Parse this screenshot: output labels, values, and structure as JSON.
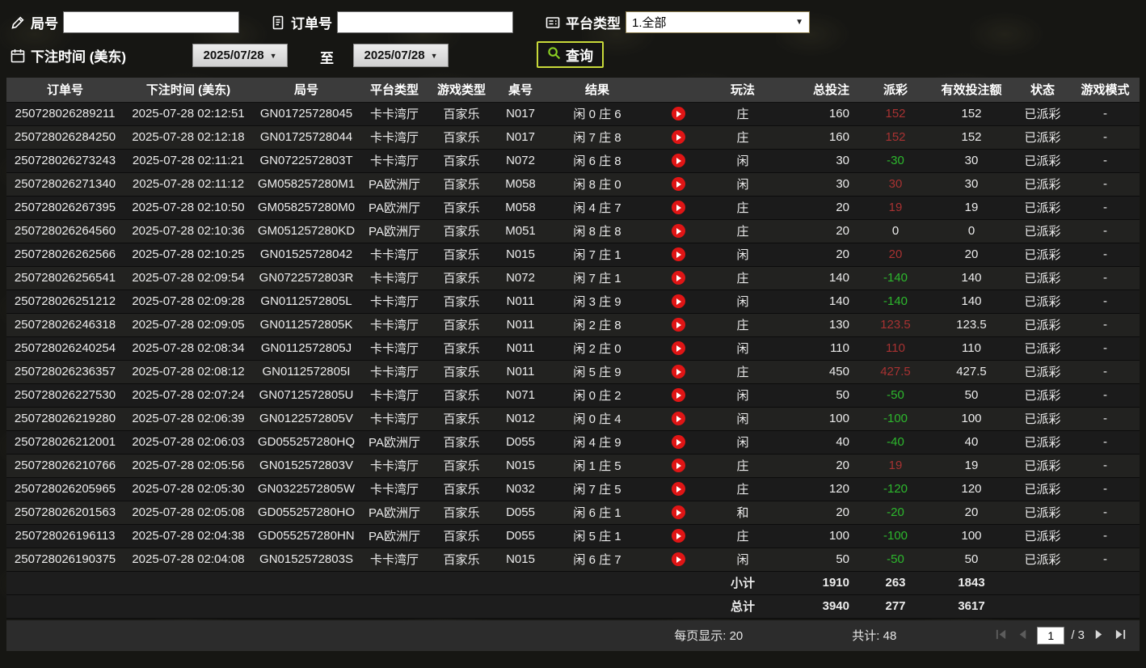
{
  "colors": {
    "accent_yellow": "#ffe100",
    "payout_win": "#a83232",
    "payout_loss": "#2db82d",
    "status_green": "#35c435",
    "header_red": "#e05050",
    "play_red": "#e01515",
    "query_border": "#c8d93a"
  },
  "icons": {
    "dropdown_arrow": "▼"
  },
  "filters": {
    "round_label": "局号",
    "order_label": "订单号",
    "platform_label": "平台类型",
    "platform_value": "1.全部",
    "bet_time_label": "下注时间 (美东)",
    "date_from": "2025/07/28",
    "to_label": "至",
    "date_to": "2025/07/28",
    "query_label": "查询",
    "round_input_value": "",
    "order_input_value": ""
  },
  "table": {
    "headers": [
      "订单号",
      "下注时间 (美东)",
      "局号",
      "平台类型",
      "游戏类型",
      "桌号",
      "结果",
      "玩法",
      "总投注",
      "派彩",
      "有效投注额",
      "状态",
      "游戏模式"
    ],
    "rows": [
      {
        "order_no": "250728026289211",
        "bet_time": "2025-07-28 02:12:51",
        "round_no": "GN01725728045",
        "platform": "卡卡湾厅",
        "game_type": "百家乐",
        "table_no": "N017",
        "result": "闲 0 庄 6",
        "play": "庄",
        "total_bet": "160",
        "payout": "152",
        "payout_class": "pos",
        "valid_bet": "152",
        "status": "已派彩",
        "mode": "-"
      },
      {
        "order_no": "250728026284250",
        "bet_time": "2025-07-28 02:12:18",
        "round_no": "GN01725728044",
        "platform": "卡卡湾厅",
        "game_type": "百家乐",
        "table_no": "N017",
        "result": "闲 7 庄 8",
        "play": "庄",
        "total_bet": "160",
        "payout": "152",
        "payout_class": "pos",
        "valid_bet": "152",
        "status": "已派彩",
        "mode": "-"
      },
      {
        "order_no": "250728026273243",
        "bet_time": "2025-07-28 02:11:21",
        "round_no": "GN0722572803T",
        "platform": "卡卡湾厅",
        "game_type": "百家乐",
        "table_no": "N072",
        "result": "闲 6 庄 8",
        "play": "闲",
        "total_bet": "30",
        "payout": "-30",
        "payout_class": "neg",
        "valid_bet": "30",
        "status": "已派彩",
        "mode": "-"
      },
      {
        "order_no": "250728026271340",
        "bet_time": "2025-07-28 02:11:12",
        "round_no": "GM058257280M1",
        "platform": "PA欧洲厅",
        "game_type": "百家乐",
        "table_no": "M058",
        "result": "闲 8 庄 0",
        "play": "闲",
        "total_bet": "30",
        "payout": "30",
        "payout_class": "pos",
        "valid_bet": "30",
        "status": "已派彩",
        "mode": "-"
      },
      {
        "order_no": "250728026267395",
        "bet_time": "2025-07-28 02:10:50",
        "round_no": "GM058257280M0",
        "platform": "PA欧洲厅",
        "game_type": "百家乐",
        "table_no": "M058",
        "result": "闲 4 庄 7",
        "play": "庄",
        "total_bet": "20",
        "payout": "19",
        "payout_class": "pos",
        "valid_bet": "19",
        "status": "已派彩",
        "mode": "-"
      },
      {
        "order_no": "250728026264560",
        "bet_time": "2025-07-28 02:10:36",
        "round_no": "GM051257280KD",
        "platform": "PA欧洲厅",
        "game_type": "百家乐",
        "table_no": "M051",
        "result": "闲 8 庄 8",
        "play": "庄",
        "total_bet": "20",
        "payout": "0",
        "payout_class": "zero",
        "valid_bet": "0",
        "status": "已派彩",
        "mode": "-"
      },
      {
        "order_no": "250728026262566",
        "bet_time": "2025-07-28 02:10:25",
        "round_no": "GN01525728042",
        "platform": "卡卡湾厅",
        "game_type": "百家乐",
        "table_no": "N015",
        "result": "闲 7 庄 1",
        "play": "闲",
        "total_bet": "20",
        "payout": "20",
        "payout_class": "pos",
        "valid_bet": "20",
        "status": "已派彩",
        "mode": "-"
      },
      {
        "order_no": "250728026256541",
        "bet_time": "2025-07-28 02:09:54",
        "round_no": "GN0722572803R",
        "platform": "卡卡湾厅",
        "game_type": "百家乐",
        "table_no": "N072",
        "result": "闲 7 庄 1",
        "play": "庄",
        "total_bet": "140",
        "payout": "-140",
        "payout_class": "neg",
        "valid_bet": "140",
        "status": "已派彩",
        "mode": "-"
      },
      {
        "order_no": "250728026251212",
        "bet_time": "2025-07-28 02:09:28",
        "round_no": "GN0112572805L",
        "platform": "卡卡湾厅",
        "game_type": "百家乐",
        "table_no": "N011",
        "result": "闲 3 庄 9",
        "play": "闲",
        "total_bet": "140",
        "payout": "-140",
        "payout_class": "neg",
        "valid_bet": "140",
        "status": "已派彩",
        "mode": "-"
      },
      {
        "order_no": "250728026246318",
        "bet_time": "2025-07-28 02:09:05",
        "round_no": "GN0112572805K",
        "platform": "卡卡湾厅",
        "game_type": "百家乐",
        "table_no": "N011",
        "result": "闲 2 庄 8",
        "play": "庄",
        "total_bet": "130",
        "payout": "123.5",
        "payout_class": "pos",
        "valid_bet": "123.5",
        "status": "已派彩",
        "mode": "-"
      },
      {
        "order_no": "250728026240254",
        "bet_time": "2025-07-28 02:08:34",
        "round_no": "GN0112572805J",
        "platform": "卡卡湾厅",
        "game_type": "百家乐",
        "table_no": "N011",
        "result": "闲 2 庄 0",
        "play": "闲",
        "total_bet": "110",
        "payout": "110",
        "payout_class": "pos",
        "valid_bet": "110",
        "status": "已派彩",
        "mode": "-"
      },
      {
        "order_no": "250728026236357",
        "bet_time": "2025-07-28 02:08:12",
        "round_no": "GN0112572805I",
        "platform": "卡卡湾厅",
        "game_type": "百家乐",
        "table_no": "N011",
        "result": "闲 5 庄 9",
        "play": "庄",
        "total_bet": "450",
        "payout": "427.5",
        "payout_class": "pos",
        "valid_bet": "427.5",
        "status": "已派彩",
        "mode": "-"
      },
      {
        "order_no": "250728026227530",
        "bet_time": "2025-07-28 02:07:24",
        "round_no": "GN0712572805U",
        "platform": "卡卡湾厅",
        "game_type": "百家乐",
        "table_no": "N071",
        "result": "闲 0 庄 2",
        "play": "闲",
        "total_bet": "50",
        "payout": "-50",
        "payout_class": "neg",
        "valid_bet": "50",
        "status": "已派彩",
        "mode": "-"
      },
      {
        "order_no": "250728026219280",
        "bet_time": "2025-07-28 02:06:39",
        "round_no": "GN0122572805V",
        "platform": "卡卡湾厅",
        "game_type": "百家乐",
        "table_no": "N012",
        "result": "闲 0 庄 4",
        "play": "闲",
        "total_bet": "100",
        "payout": "-100",
        "payout_class": "neg",
        "valid_bet": "100",
        "status": "已派彩",
        "mode": "-"
      },
      {
        "order_no": "250728026212001",
        "bet_time": "2025-07-28 02:06:03",
        "round_no": "GD055257280HQ",
        "platform": "PA欧洲厅",
        "game_type": "百家乐",
        "table_no": "D055",
        "result": "闲 4 庄 9",
        "play": "闲",
        "total_bet": "40",
        "payout": "-40",
        "payout_class": "neg",
        "valid_bet": "40",
        "status": "已派彩",
        "mode": "-"
      },
      {
        "order_no": "250728026210766",
        "bet_time": "2025-07-28 02:05:56",
        "round_no": "GN0152572803V",
        "platform": "卡卡湾厅",
        "game_type": "百家乐",
        "table_no": "N015",
        "result": "闲 1 庄 5",
        "play": "庄",
        "total_bet": "20",
        "payout": "19",
        "payout_class": "pos",
        "valid_bet": "19",
        "status": "已派彩",
        "mode": "-"
      },
      {
        "order_no": "250728026205965",
        "bet_time": "2025-07-28 02:05:30",
        "round_no": "GN0322572805W",
        "platform": "卡卡湾厅",
        "game_type": "百家乐",
        "table_no": "N032",
        "result": "闲 7 庄 5",
        "play": "庄",
        "total_bet": "120",
        "payout": "-120",
        "payout_class": "neg",
        "valid_bet": "120",
        "status": "已派彩",
        "mode": "-"
      },
      {
        "order_no": "250728026201563",
        "bet_time": "2025-07-28 02:05:08",
        "round_no": "GD055257280HO",
        "platform": "PA欧洲厅",
        "game_type": "百家乐",
        "table_no": "D055",
        "result": "闲 6 庄 1",
        "play": "和",
        "total_bet": "20",
        "payout": "-20",
        "payout_class": "neg",
        "valid_bet": "20",
        "status": "已派彩",
        "mode": "-"
      },
      {
        "order_no": "250728026196113",
        "bet_time": "2025-07-28 02:04:38",
        "round_no": "GD055257280HN",
        "platform": "PA欧洲厅",
        "game_type": "百家乐",
        "table_no": "D055",
        "result": "闲 5 庄 1",
        "play": "庄",
        "total_bet": "100",
        "payout": "-100",
        "payout_class": "neg",
        "valid_bet": "100",
        "status": "已派彩",
        "mode": "-"
      },
      {
        "order_no": "250728026190375",
        "bet_time": "2025-07-28 02:04:08",
        "round_no": "GN0152572803S",
        "platform": "卡卡湾厅",
        "game_type": "百家乐",
        "table_no": "N015",
        "result": "闲 6 庄 7",
        "play": "闲",
        "total_bet": "50",
        "payout": "-50",
        "payout_class": "neg",
        "valid_bet": "50",
        "status": "已派彩",
        "mode": "-"
      }
    ]
  },
  "summary": {
    "subtotal_label": "小计",
    "subtotal": {
      "total_bet": "1910",
      "payout": "263",
      "valid_bet": "1843"
    },
    "total_label": "总计",
    "total": {
      "total_bet": "3940",
      "payout": "277",
      "valid_bet": "3617"
    }
  },
  "pagination": {
    "per_page_label": "每页显示:",
    "per_page_value": "20",
    "total_label": "共计:",
    "total_value": "48",
    "current_page": "1",
    "page_separator": "/",
    "total_pages": "3"
  }
}
